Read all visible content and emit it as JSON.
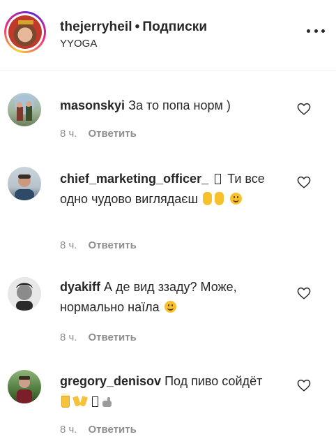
{
  "header": {
    "username": "thejerryheil",
    "separator": "•",
    "follow_state": "Подписки",
    "location": "YYOGA",
    "more_icon": "more-horizontal-icon"
  },
  "comments": [
    {
      "username": "masonskyi",
      "text": "За то попа норм )",
      "time": "8 ч.",
      "reply_label": "Ответить",
      "avatar_icon": "avatar-photo"
    },
    {
      "username": "chief_marketing_officer_",
      "text": "Ти все одно чудово виглядаєш",
      "time": "8 ч.",
      "reply_label": "Ответить",
      "avatar_icon": "avatar-photo"
    },
    {
      "username": "dyakiff",
      "text": "А де вид ззаду? Може, нормально наїла",
      "time": "8 ч.",
      "reply_label": "Ответить",
      "avatar_icon": "avatar-photo"
    },
    {
      "username": "gregory_denisov",
      "text": "Под пиво сойдёт",
      "time": "8 ч.",
      "reply_label": "Ответить",
      "avatar_icon": "avatar-photo"
    }
  ],
  "colors": {
    "text": "#262626",
    "muted": "#8e8e8e",
    "divider": "#efefef"
  }
}
